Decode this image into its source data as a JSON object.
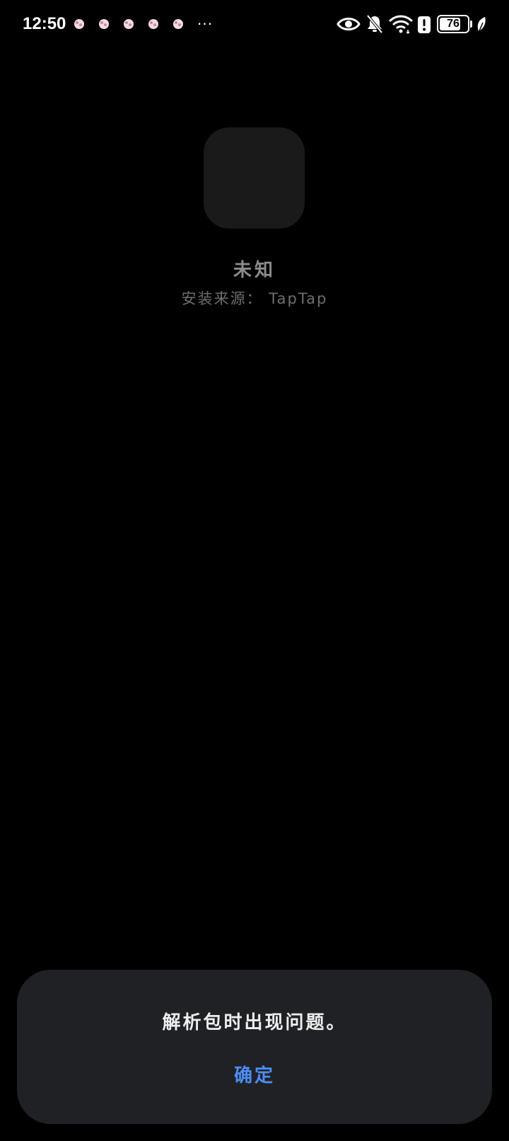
{
  "status_bar": {
    "time": "12:50",
    "notification_icons": [
      "app-notification-icon",
      "app-notification-icon",
      "app-notification-icon",
      "app-notification-icon",
      "app-notification-icon"
    ],
    "more_indicator": "···",
    "system_icons": [
      "eye-icon",
      "bell-off-icon",
      "wifi-icon",
      "alert-icon"
    ],
    "battery_level": "76",
    "battery_fraction": 0.76
  },
  "app": {
    "name": "未知",
    "install_source": "安装来源： TapTap"
  },
  "dialog": {
    "message": "解析包时出现问题。",
    "confirm_label": "确定"
  },
  "colors": {
    "background": "#000000",
    "dialog_background": "#202124",
    "accent": "#4a8ef7"
  }
}
